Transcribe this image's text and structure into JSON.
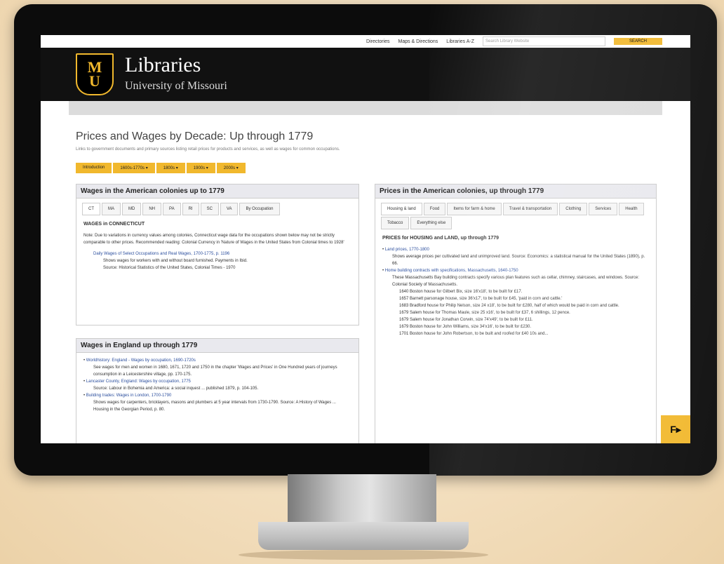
{
  "util": {
    "links": [
      "Directories",
      "Maps & Directions",
      "Libraries A-Z"
    ],
    "search_placeholder": "Search Library Website",
    "search_button": "SEARCH"
  },
  "header": {
    "logo_top": "M",
    "logo_bottom": "U",
    "title": "Libraries",
    "subtitle": "University of Missouri"
  },
  "page": {
    "title": "Prices and Wages by Decade: Up through 1779",
    "subtitle": "Links to government documents and primary sources listing retail prices for products and services, as well as wages for common occupations."
  },
  "top_tabs": [
    "Introduction",
    "1600s-1770s ▾",
    "1800s ▾",
    "1900s ▾",
    "2000s ▾"
  ],
  "left_panel": {
    "title": "Wages in the American colonies up to 1779",
    "tabs": [
      "CT",
      "MA",
      "MD",
      "NH",
      "PA",
      "RI",
      "SC",
      "VA",
      "By Occupation"
    ],
    "heading": "WAGES in CONNECTICUT",
    "note": "Note: Due to variations in currency values among colonies, Connecticut wage data for the occupations shown below may not be strictly comparable to other prices. Recommended reading: Colonial Currency in 'Nature of Wages in the United States from Colonial times to 1928'",
    "item_link": "Daily Wages of Select Occupations and Real Wages, 1700-1775, p. 1196",
    "item_sub": "Shows wages for workers with and without board furnished. Payments in Ibid.",
    "item_source": "Source: Historical Statistics of the United States, Colonial Times - 1970"
  },
  "left_panel2": {
    "title": "Wages in England up through 1779",
    "items": [
      {
        "link": "Worldhistory: England - Wages by occupation, 1690-1720s",
        "text": "See wages for men and women in 1680, 1671, 1720 and 1750 in the chapter 'Wages and Prices' in One Hundred years of journeys consumption in a Leicestershire village, pp. 170-175."
      },
      {
        "link": "Lancaster County, England: Wages by occupation, 1775",
        "text": "Source: Labour in Bohemia and America: a social inquest ... published 1879, p. 104-105."
      },
      {
        "link": "Building trades: Wages in London, 1700-1790",
        "text": "Shows wages for carpenters, bricklayers, masons and plumbers at 5 year intervals from 1730-1790. Source: A History of Wages ... Housing in the Georgian Period, p. 80."
      }
    ]
  },
  "right_panel": {
    "title": "Prices in the American colonies, up through 1779",
    "tabs": [
      "Housing & land",
      "Food",
      "Items for farm & home",
      "Travel & transportation",
      "Clothing",
      "Services",
      "Health",
      "Tobacco",
      "Everything else"
    ],
    "heading": "PRICES for HOUSING and LAND, up through 1779",
    "items": [
      {
        "link": "Land prices, 1770-1800",
        "text": "Shows average prices per cultivated land and unimproved land. Source: Economics: a statistical manual for the United States (1890), p. 66."
      },
      {
        "link": "Home building contracts with specifications, Massachusetts, 1640-1750",
        "text": "These Massachusetts Bay building contracts specify various plan features such as cellar, chimney, staircases, and windows. Source: Colonial Society of Massachusetts."
      }
    ],
    "sub_items": [
      "1640 Boston house for Gilbert Bix, size 16'x18', to be built for £17.",
      "1657 Barnett parsonage house, size 36'x17', to be built for £45, 'paid in corn and cattle.'",
      "1683 Bradford house for Philip Nelson, size 24 x18', to be built for £280, half of which would be paid in corn and cattle.",
      "1679 Salem house for Thomas Maule, size 25 x16', to be built for £37, 6 shillings, 12 pence.",
      "1679 Salem house for Jonathan Corwin, size 74'x49', to be built for £11.",
      "1679 Boston house for John Williams, size 34'x16', to be built for £230.",
      "1701 Boston house for John Robertson, to be built and roofed for £40 10s and..."
    ]
  },
  "corner_button": "F▸"
}
